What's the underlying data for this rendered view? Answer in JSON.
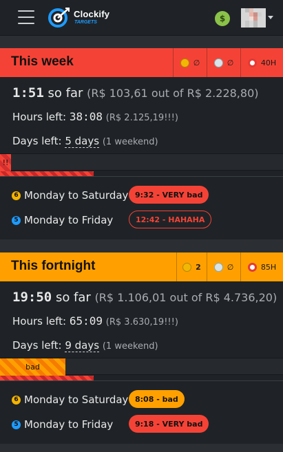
{
  "app": {
    "brand": "Clockify",
    "brand_sub": "TARGETS",
    "money_icon": "money-face-icon",
    "menu_icon": "hamburger-menu-icon"
  },
  "colors": {
    "week_accent": "#f44336",
    "fortnight_accent": "#ffa000",
    "card_bg": "#1f2327",
    "page_bg": "#2b2f33"
  },
  "week": {
    "title": "This week",
    "stats": [
      {
        "icon": "sick-face-icon",
        "value": "∅"
      },
      {
        "icon": "beach-icon",
        "value": "∅"
      },
      {
        "icon": "target-icon",
        "value": "40H"
      }
    ],
    "so_far_time": "1:51",
    "so_far_label": "so far",
    "so_far_money": "(R$ 103,61 out of R$ 2.228,80)",
    "hours_left_label": "Hours left:",
    "hours_left_time": "38:08",
    "hours_left_money": "(R$ 2.125,19!!!)",
    "days_left_label": "Days left:",
    "days_left_value": "5 days",
    "days_left_note": "(1 weekend)",
    "progress_label": "!!",
    "progress_fraction": 0.04,
    "schedule_fraction": 0.33,
    "rows": [
      {
        "icon": "six-circle-icon",
        "num": "6",
        "label": "Monday to Saturday",
        "badge": "9:32 - VERY bad"
      },
      {
        "icon": "five-circle-icon",
        "num": "5",
        "label": "Monday to Friday",
        "badge": "12:42 - HAHAHA"
      }
    ]
  },
  "fortnight": {
    "title": "This fortnight",
    "stats": [
      {
        "icon": "sick-face-icon",
        "value": "2"
      },
      {
        "icon": "beach-icon",
        "value": "∅"
      },
      {
        "icon": "target-icon",
        "value": "85H"
      }
    ],
    "so_far_time": "19:50",
    "so_far_label": "so far",
    "so_far_money": "(R$ 1.106,01 out of R$ 4.736,20)",
    "hours_left_label": "Hours left:",
    "hours_left_time": "65:09",
    "hours_left_money": "(R$ 3.630,19!!!)",
    "days_left_label": "Days left:",
    "days_left_value": "9 days",
    "days_left_note": "(1 weekend)",
    "progress_label": "bad",
    "progress_fraction": 0.23,
    "schedule_fraction": 0.33,
    "rows": [
      {
        "icon": "six-circle-icon",
        "num": "6",
        "label": "Monday to Saturday",
        "badge": "8:08 - bad"
      },
      {
        "icon": "five-circle-icon",
        "num": "5",
        "label": "Monday to Friday",
        "badge": "9:18 - VERY bad"
      }
    ]
  }
}
